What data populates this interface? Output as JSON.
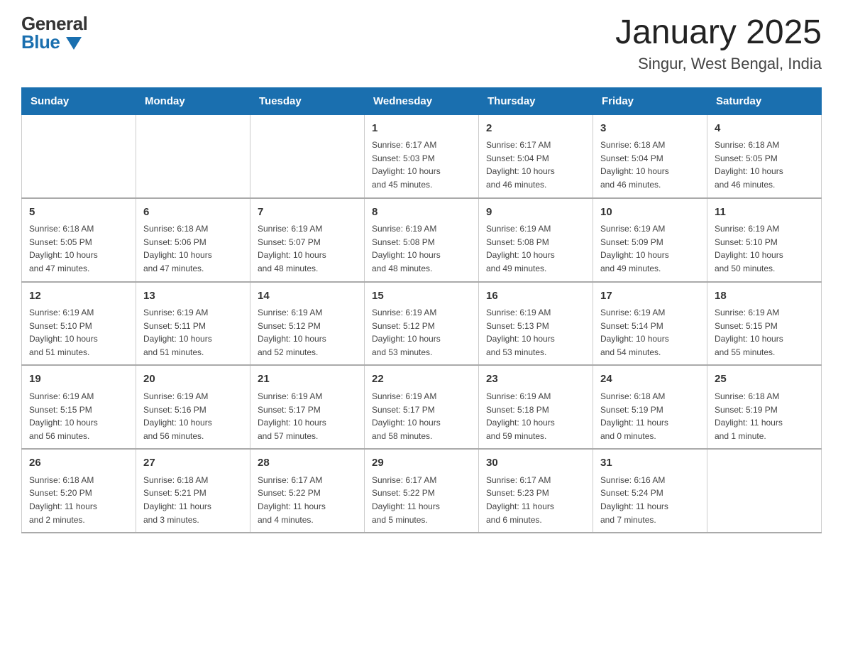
{
  "header": {
    "logo": {
      "general": "General",
      "blue": "Blue"
    },
    "title": "January 2025",
    "subtitle": "Singur, West Bengal, India"
  },
  "calendar": {
    "headers": [
      "Sunday",
      "Monday",
      "Tuesday",
      "Wednesday",
      "Thursday",
      "Friday",
      "Saturday"
    ],
    "weeks": [
      [
        {
          "day": "",
          "info": ""
        },
        {
          "day": "",
          "info": ""
        },
        {
          "day": "",
          "info": ""
        },
        {
          "day": "1",
          "info": "Sunrise: 6:17 AM\nSunset: 5:03 PM\nDaylight: 10 hours\nand 45 minutes."
        },
        {
          "day": "2",
          "info": "Sunrise: 6:17 AM\nSunset: 5:04 PM\nDaylight: 10 hours\nand 46 minutes."
        },
        {
          "day": "3",
          "info": "Sunrise: 6:18 AM\nSunset: 5:04 PM\nDaylight: 10 hours\nand 46 minutes."
        },
        {
          "day": "4",
          "info": "Sunrise: 6:18 AM\nSunset: 5:05 PM\nDaylight: 10 hours\nand 46 minutes."
        }
      ],
      [
        {
          "day": "5",
          "info": "Sunrise: 6:18 AM\nSunset: 5:05 PM\nDaylight: 10 hours\nand 47 minutes."
        },
        {
          "day": "6",
          "info": "Sunrise: 6:18 AM\nSunset: 5:06 PM\nDaylight: 10 hours\nand 47 minutes."
        },
        {
          "day": "7",
          "info": "Sunrise: 6:19 AM\nSunset: 5:07 PM\nDaylight: 10 hours\nand 48 minutes."
        },
        {
          "day": "8",
          "info": "Sunrise: 6:19 AM\nSunset: 5:08 PM\nDaylight: 10 hours\nand 48 minutes."
        },
        {
          "day": "9",
          "info": "Sunrise: 6:19 AM\nSunset: 5:08 PM\nDaylight: 10 hours\nand 49 minutes."
        },
        {
          "day": "10",
          "info": "Sunrise: 6:19 AM\nSunset: 5:09 PM\nDaylight: 10 hours\nand 49 minutes."
        },
        {
          "day": "11",
          "info": "Sunrise: 6:19 AM\nSunset: 5:10 PM\nDaylight: 10 hours\nand 50 minutes."
        }
      ],
      [
        {
          "day": "12",
          "info": "Sunrise: 6:19 AM\nSunset: 5:10 PM\nDaylight: 10 hours\nand 51 minutes."
        },
        {
          "day": "13",
          "info": "Sunrise: 6:19 AM\nSunset: 5:11 PM\nDaylight: 10 hours\nand 51 minutes."
        },
        {
          "day": "14",
          "info": "Sunrise: 6:19 AM\nSunset: 5:12 PM\nDaylight: 10 hours\nand 52 minutes."
        },
        {
          "day": "15",
          "info": "Sunrise: 6:19 AM\nSunset: 5:12 PM\nDaylight: 10 hours\nand 53 minutes."
        },
        {
          "day": "16",
          "info": "Sunrise: 6:19 AM\nSunset: 5:13 PM\nDaylight: 10 hours\nand 53 minutes."
        },
        {
          "day": "17",
          "info": "Sunrise: 6:19 AM\nSunset: 5:14 PM\nDaylight: 10 hours\nand 54 minutes."
        },
        {
          "day": "18",
          "info": "Sunrise: 6:19 AM\nSunset: 5:15 PM\nDaylight: 10 hours\nand 55 minutes."
        }
      ],
      [
        {
          "day": "19",
          "info": "Sunrise: 6:19 AM\nSunset: 5:15 PM\nDaylight: 10 hours\nand 56 minutes."
        },
        {
          "day": "20",
          "info": "Sunrise: 6:19 AM\nSunset: 5:16 PM\nDaylight: 10 hours\nand 56 minutes."
        },
        {
          "day": "21",
          "info": "Sunrise: 6:19 AM\nSunset: 5:17 PM\nDaylight: 10 hours\nand 57 minutes."
        },
        {
          "day": "22",
          "info": "Sunrise: 6:19 AM\nSunset: 5:17 PM\nDaylight: 10 hours\nand 58 minutes."
        },
        {
          "day": "23",
          "info": "Sunrise: 6:19 AM\nSunset: 5:18 PM\nDaylight: 10 hours\nand 59 minutes."
        },
        {
          "day": "24",
          "info": "Sunrise: 6:18 AM\nSunset: 5:19 PM\nDaylight: 11 hours\nand 0 minutes."
        },
        {
          "day": "25",
          "info": "Sunrise: 6:18 AM\nSunset: 5:19 PM\nDaylight: 11 hours\nand 1 minute."
        }
      ],
      [
        {
          "day": "26",
          "info": "Sunrise: 6:18 AM\nSunset: 5:20 PM\nDaylight: 11 hours\nand 2 minutes."
        },
        {
          "day": "27",
          "info": "Sunrise: 6:18 AM\nSunset: 5:21 PM\nDaylight: 11 hours\nand 3 minutes."
        },
        {
          "day": "28",
          "info": "Sunrise: 6:17 AM\nSunset: 5:22 PM\nDaylight: 11 hours\nand 4 minutes."
        },
        {
          "day": "29",
          "info": "Sunrise: 6:17 AM\nSunset: 5:22 PM\nDaylight: 11 hours\nand 5 minutes."
        },
        {
          "day": "30",
          "info": "Sunrise: 6:17 AM\nSunset: 5:23 PM\nDaylight: 11 hours\nand 6 minutes."
        },
        {
          "day": "31",
          "info": "Sunrise: 6:16 AM\nSunset: 5:24 PM\nDaylight: 11 hours\nand 7 minutes."
        },
        {
          "day": "",
          "info": ""
        }
      ]
    ]
  }
}
